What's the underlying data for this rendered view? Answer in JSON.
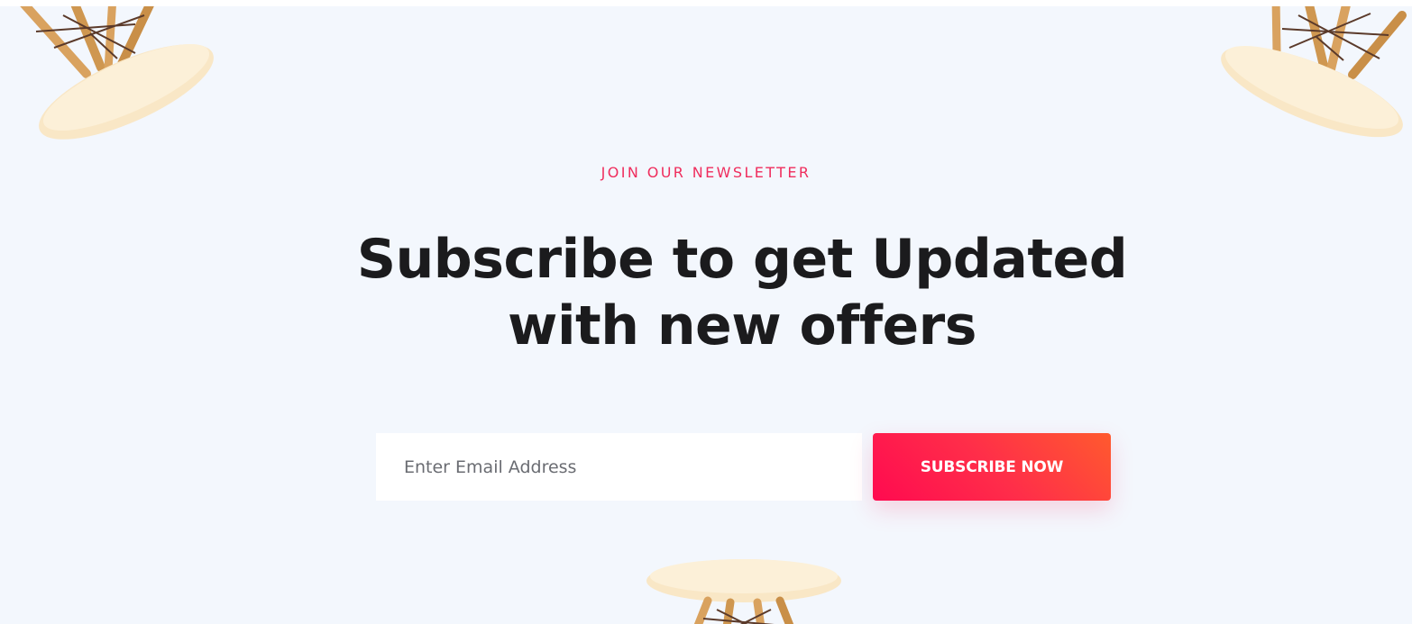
{
  "newsletter": {
    "eyebrow": "JOIN OUR NEWSLETTER",
    "headline_line1": "Subscribe to get Updated",
    "headline_line2": "with new offers",
    "email_placeholder": "Enter Email Address",
    "subscribe_label": "SUBSCRIBE NOW"
  },
  "colors": {
    "section_background": "#f3f7fd",
    "accent": "#ef2d5d",
    "button_gradient_start": "#ff0a50",
    "button_gradient_end": "#ff5a2e",
    "headline": "#1b1b1d"
  },
  "icons": {
    "decorations": [
      "stool-image",
      "stool-image",
      "stool-image"
    ]
  }
}
